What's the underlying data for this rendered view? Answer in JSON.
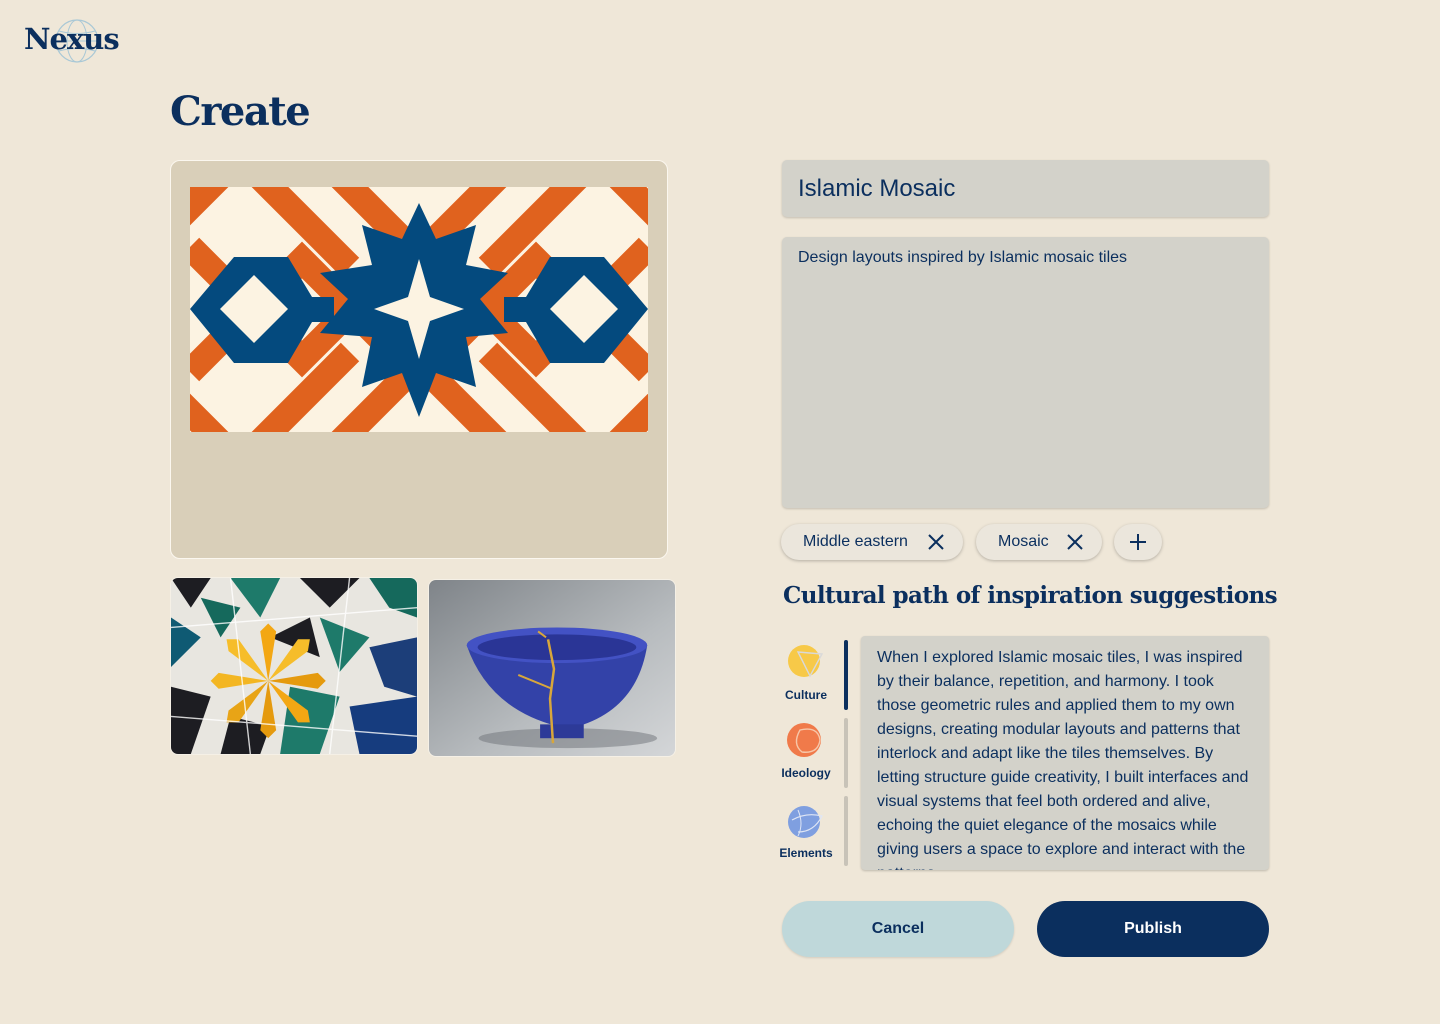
{
  "brand": {
    "name": "Nexus",
    "logo_icon": "globe-icon"
  },
  "page": {
    "title": "Create"
  },
  "form": {
    "title_value": "Islamic Mosaic",
    "description_value": "Design layouts inspired by Islamic mosaic tiles",
    "tags": [
      {
        "label": "Middle eastern",
        "remove_icon": "close-icon"
      },
      {
        "label": "Mosaic",
        "remove_icon": "close-icon"
      }
    ],
    "add_tag_icon": "plus-icon"
  },
  "inspiration": {
    "title": "Cultural path of inspiration suggestions",
    "categories": [
      {
        "label": "Culture",
        "icon": "culture-icon",
        "color": "#f7c948",
        "active": true
      },
      {
        "label": "Ideology",
        "icon": "ideology-icon",
        "color": "#f07a4a",
        "active": false
      },
      {
        "label": "Elements",
        "icon": "elements-icon",
        "color": "#7f9fe0",
        "active": false
      }
    ],
    "story": "When I explored Islamic mosaic tiles, I was inspired by their balance, repetition, and harmony. I took those geometric rules and applied them to my own designs, creating modular layouts and patterns that interlock and adapt like the tiles themselves. By letting structure guide creativity, I built interfaces and visual systems that feel both ordered and alive, echoing the quiet elegance of the mosaics while giving users a space to explore and interact with the patterns."
  },
  "actions": {
    "cancel_label": "Cancel",
    "publish_label": "Publish"
  },
  "colors": {
    "background": "#efe7d8",
    "primary": "#0b2f5e",
    "accent_orange": "#e0621e",
    "tile_blue": "#044a7e",
    "cancel_bg": "#bfd8da"
  }
}
